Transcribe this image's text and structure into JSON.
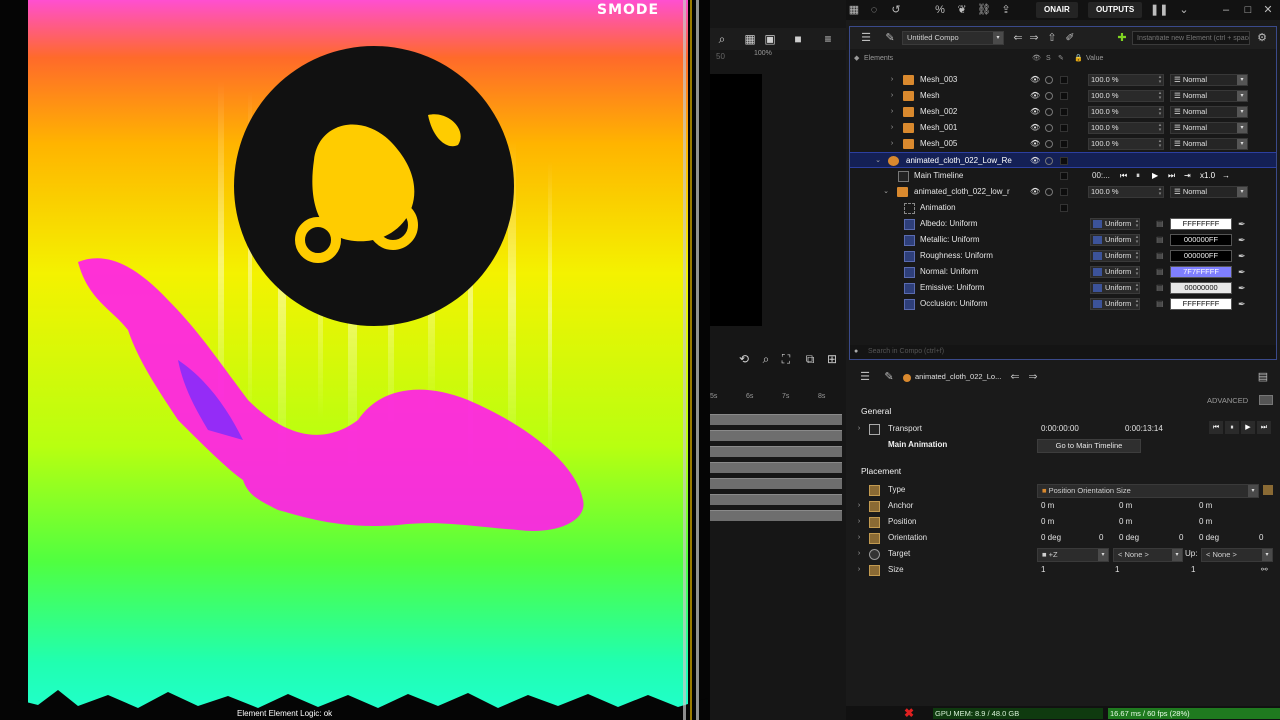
{
  "viewport": {
    "title": "SMODE",
    "status": "Element Element Logic: ok"
  },
  "middle": {
    "zoom": "100%",
    "frame": "50",
    "ticks": [
      "5s",
      "6s",
      "7s",
      "8s"
    ]
  },
  "topbar": {
    "onair": "ONAIR",
    "outputs": "OUTPUTS"
  },
  "compo": {
    "compo_name": "Untitled Compo",
    "new_element_placeholder": "Instantiate new Element (ctrl + spacebar)",
    "header": {
      "elements": "Elements",
      "solo": "S",
      "value": "Value"
    },
    "meshes": [
      {
        "name": "Mesh_003",
        "opacity": "100.0 %",
        "blend": "Normal"
      },
      {
        "name": "Mesh",
        "opacity": "100.0 %",
        "blend": "Normal"
      },
      {
        "name": "Mesh_002",
        "opacity": "100.0 %",
        "blend": "Normal"
      },
      {
        "name": "Mesh_001",
        "opacity": "100.0 %",
        "blend": "Normal"
      },
      {
        "name": "Mesh_005",
        "opacity": "100.0 %",
        "blend": "Normal"
      }
    ],
    "selected": {
      "name": "animated_cloth_022_Low_Re"
    },
    "timeline": {
      "name": "Main Timeline",
      "time": "00:...",
      "speed": "x1.0"
    },
    "child": {
      "name": "animated_cloth_022_low_r",
      "opacity": "100.0 %",
      "blend": "Normal"
    },
    "animation": "Animation",
    "materials": [
      {
        "name": "Albedo: Uniform",
        "mode": "Uniform",
        "color": "FFFFFFFF",
        "swatch": "#ffffff",
        "text": "#111111"
      },
      {
        "name": "Metallic: Uniform",
        "mode": "Uniform",
        "color": "000000FF",
        "swatch": "#000000",
        "text": "#eeeeee"
      },
      {
        "name": "Roughness: Uniform",
        "mode": "Uniform",
        "color": "000000FF",
        "swatch": "#000000",
        "text": "#eeeeee"
      },
      {
        "name": "Normal: Uniform",
        "mode": "Uniform",
        "color": "7F7FFFFF",
        "swatch": "#7f7fff",
        "text": "#ffffff"
      },
      {
        "name": "Emissive: Uniform",
        "mode": "Uniform",
        "color": "00000000",
        "swatch": "#e8e8e8",
        "text": "#111111"
      },
      {
        "name": "Occlusion: Uniform",
        "mode": "Uniform",
        "color": "FFFFFFFF",
        "swatch": "#ffffff",
        "text": "#111111"
      }
    ],
    "search_placeholder": "Search in Compo (ctrl+f)"
  },
  "inspector": {
    "element_name": "animated_cloth_022_Lo...",
    "advanced": "ADVANCED",
    "general": "General",
    "transport": {
      "label": "Transport",
      "start": "0:00:00:00",
      "end": "0:00:13:14"
    },
    "main_animation": {
      "label": "Main Animation",
      "button": "Go to Main Timeline"
    },
    "placement": "Placement",
    "type": {
      "label": "Type",
      "value": "Position Orientation Size"
    },
    "anchor": {
      "label": "Anchor",
      "values": [
        "0 m",
        "0 m",
        "0 m"
      ]
    },
    "position": {
      "label": "Position",
      "values": [
        "0 m",
        "0 m",
        "0 m"
      ]
    },
    "orientation": {
      "label": "Orientation",
      "values": [
        "0 deg",
        "0",
        "0 deg",
        "0",
        "0 deg",
        "0"
      ]
    },
    "target": {
      "label": "Target",
      "axis": "+Z",
      "target": "< None >",
      "up_label": "Up:",
      "up": "< None >"
    },
    "size": {
      "label": "Size",
      "values": [
        "1",
        "1",
        "1"
      ]
    }
  },
  "status": {
    "gpu": "GPU MEM: 8.9 / 48.0 GB",
    "fps": "16.67 ms / 60 fps (28%)"
  },
  "colors": {
    "accent": "#2c3fa0",
    "element_icon": "#d9892e",
    "fps_ok": "#1f7a1f",
    "error": "#e02020"
  }
}
